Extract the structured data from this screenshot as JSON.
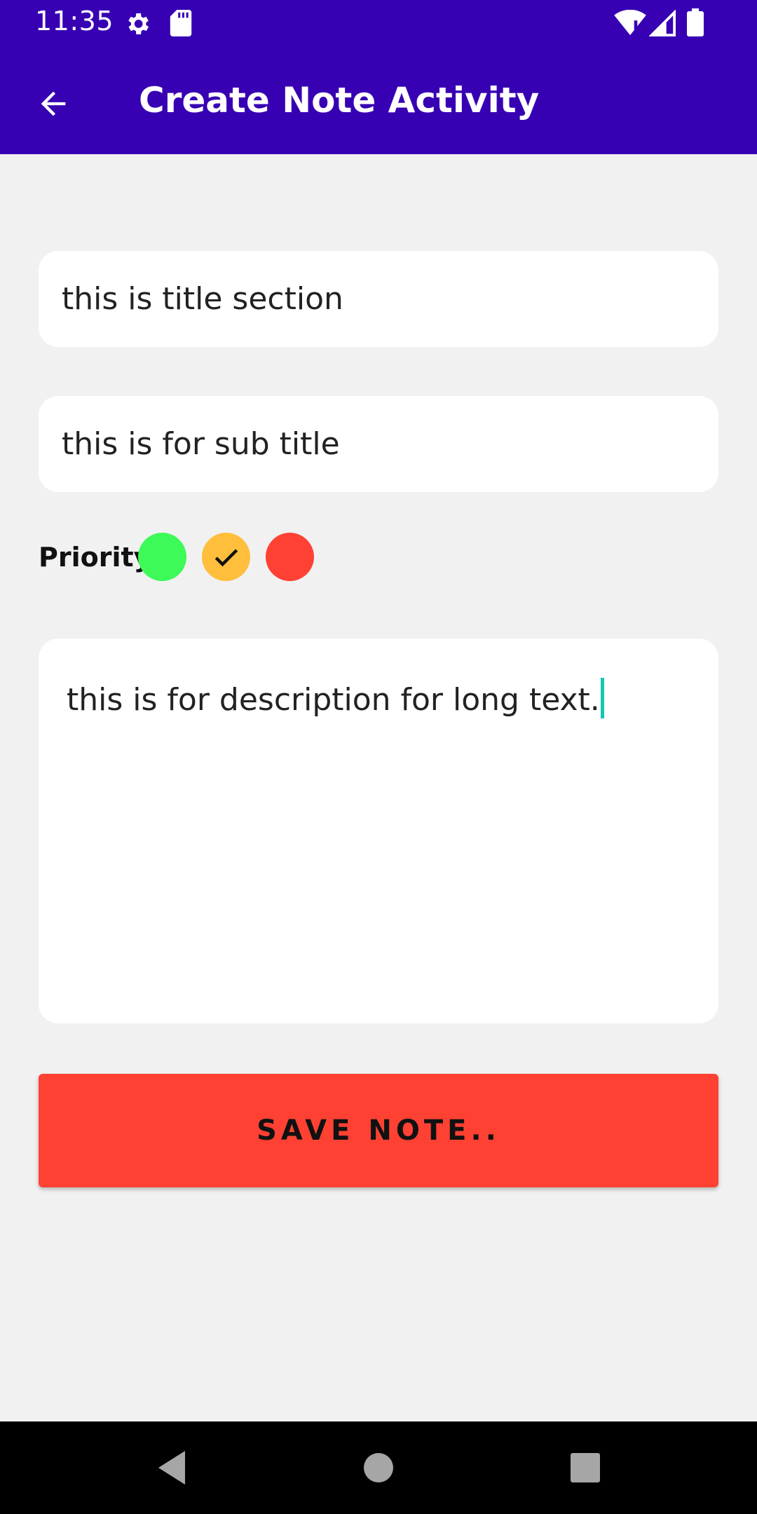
{
  "status_bar": {
    "time": "11:35",
    "icons": [
      "settings-icon",
      "sd-card-icon",
      "wifi-icon",
      "signal-icon",
      "battery-icon"
    ]
  },
  "app_bar": {
    "title": "Create Note Activity",
    "back_icon": "arrow-back-icon",
    "background": "#3700b3"
  },
  "form": {
    "title_value": "this is title section",
    "subtitle_value": "this is for sub title",
    "priority_label": "Priority",
    "priority_options": [
      {
        "name": "green",
        "color": "#3dfa58",
        "selected": false
      },
      {
        "name": "yellow",
        "color": "#ffbe3b",
        "selected": true
      },
      {
        "name": "red",
        "color": "#ff4133",
        "selected": false
      }
    ],
    "description_value": "this is for description for long text.",
    "save_label": "SAVE NOTE.."
  },
  "nav_bar": {
    "icons": [
      "back-triangle-icon",
      "home-circle-icon",
      "recents-square-icon"
    ]
  }
}
